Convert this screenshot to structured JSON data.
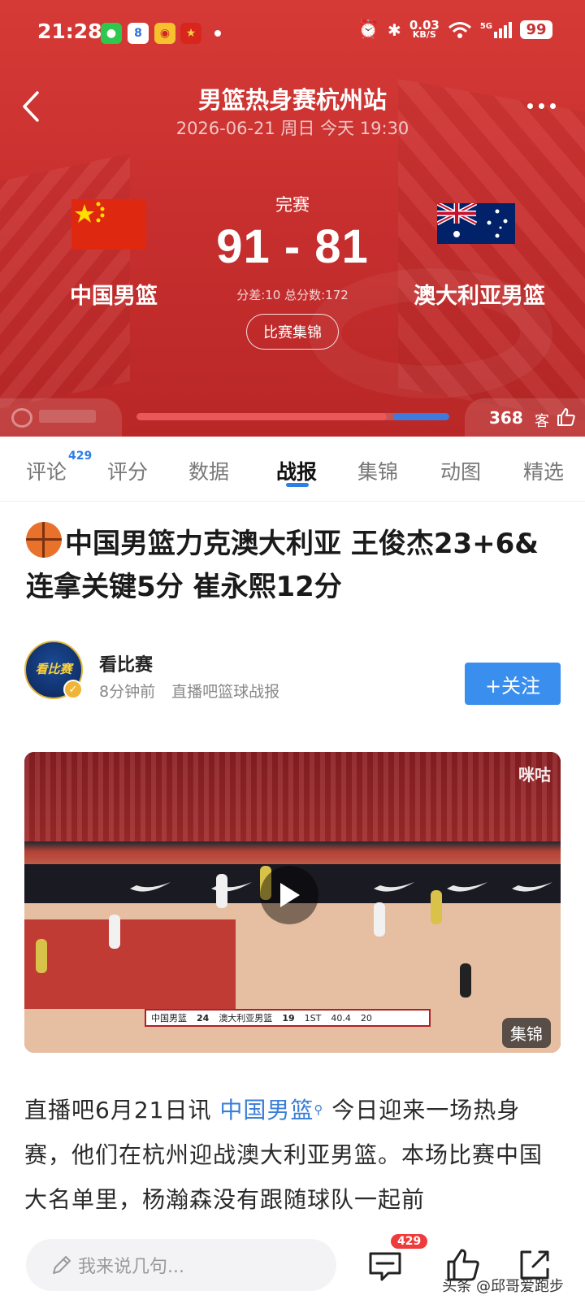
{
  "status_bar": {
    "time": "21:28",
    "net_speed_value": "0.03",
    "net_speed_unit": "KB/S",
    "signal_label": "5G",
    "battery": "99"
  },
  "header": {
    "title": "男篮热身赛杭州站",
    "subtitle": "2026-06-21 周日 今天 19:30",
    "state": "完赛",
    "score": "91 - 81",
    "score_info": "分差:10 总分数:172",
    "home_team": "中国男篮",
    "away_team": "澳大利亚男篮",
    "highlights_button": "比赛集锦",
    "home_vote_fraction": 0.8,
    "viewer_count": "368",
    "viewer_unit": "客"
  },
  "tabs": [
    {
      "label": "评论",
      "badge": "429"
    },
    {
      "label": "评分"
    },
    {
      "label": "数据"
    },
    {
      "label": "战报",
      "active": true
    },
    {
      "label": "集锦"
    },
    {
      "label": "动图"
    },
    {
      "label": "精选"
    }
  ],
  "article": {
    "headline": "中国男篮力克澳大利亚 王俊杰23+6&连拿关键5分 崔永熙12分",
    "author": {
      "name": "看比赛",
      "time": "8分钟前",
      "source": "直播吧篮球战报",
      "avatar_text": "看比赛"
    },
    "follow_button": "+关注",
    "video": {
      "watermark": "咪咕",
      "tag": "集锦",
      "overlay": {
        "home": "中国男篮",
        "home_score": "24",
        "away": "澳大利亚男篮",
        "away_score": "19",
        "period": "1ST",
        "clock": "40.4",
        "shot": "20"
      }
    },
    "body_prefix": "直播吧6月21日讯 ",
    "body_link": "中国男篮",
    "body_suffix": " 今日迎来一场热身赛，他们在杭州迎战澳大利亚男篮。本场比赛中国大名单里，杨瀚森没有跟随球队一起前"
  },
  "bottom_bar": {
    "input_placeholder": "我来说几句...",
    "comment_count": "429",
    "watermark": "头条 @邱哥爱跑步"
  },
  "colors": {
    "hero_red": "#c8302f",
    "accent_blue": "#3a8eee",
    "badge_red": "#ee3b3b"
  }
}
